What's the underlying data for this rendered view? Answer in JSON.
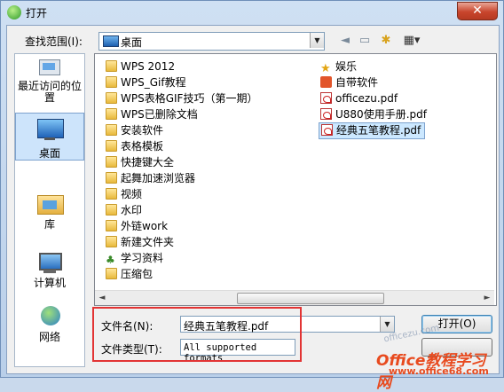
{
  "window": {
    "title": "打开",
    "close": "✕"
  },
  "lookin": {
    "label": "查找范围(I):",
    "value": "桌面"
  },
  "places": [
    {
      "label": "最近访问的位置"
    },
    {
      "label": "桌面"
    },
    {
      "label": "库"
    },
    {
      "label": "计算机"
    },
    {
      "label": "网络"
    }
  ],
  "files_left": [
    "WPS 2012",
    "WPS_Gif教程",
    "WPS表格GIF技巧（第一期）",
    "WPS已删除文档",
    "安装软件",
    "表格模板",
    "快捷键大全",
    "起舞加速浏览器",
    "视频",
    "水印",
    "外链work",
    "新建文件夹",
    "学习资料",
    "压缩包"
  ],
  "files_right": [
    "娱乐",
    "自带软件",
    "officezu.pdf",
    "U880使用手册.pdf",
    "经典五笔教程.pdf"
  ],
  "filename": {
    "label": "文件名(N):",
    "value": "经典五笔教程.pdf"
  },
  "filetype": {
    "label": "文件类型(T):",
    "value": "All supported formats"
  },
  "buttons": {
    "open": "打开(O)"
  },
  "watermark": {
    "line1": "officezu.com",
    "line2": "Office教程学习网",
    "line3": "www.office68.com"
  },
  "colors": {
    "highlight": "#e23434",
    "selection": "#cce8ff"
  }
}
